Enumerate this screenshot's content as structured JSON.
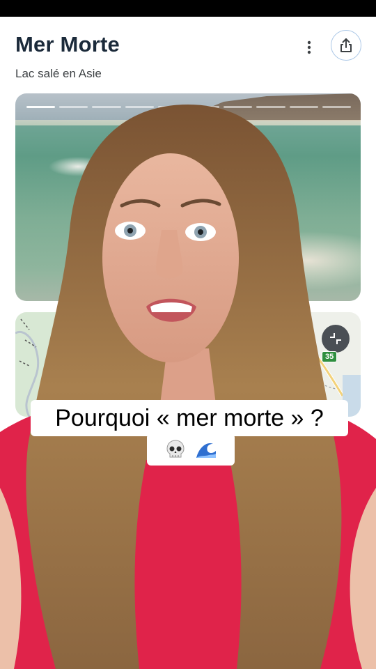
{
  "place": {
    "title": "Mer Morte",
    "subtitle": "Lac salé en Asie"
  },
  "header_actions": {
    "more_icon": "more-vertical-icon",
    "share_icon": "share-icon"
  },
  "photo": {
    "story_segments": 10,
    "segments_viewed": 1
  },
  "map": {
    "road_number": "35",
    "expand_icon": "collapse-arrows-icon"
  },
  "caption": {
    "line1": "Pourquoi « mer morte » ?",
    "line2_emojis": [
      "skull-emoji",
      "wave-emoji"
    ]
  },
  "colors": {
    "title": "#1b2a3a",
    "share_ring": "#a9c6e6",
    "shirt": "#e0234a",
    "hair": "#9b7045"
  }
}
